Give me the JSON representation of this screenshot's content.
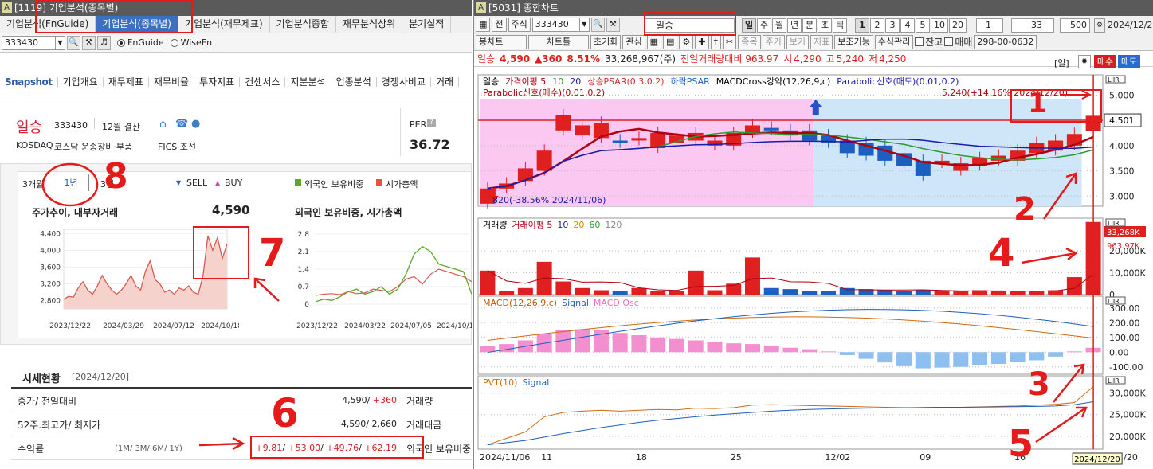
{
  "left": {
    "window_title": "[1119] 기업분석(종목별)",
    "window_icon": "A",
    "tabs": [
      "기업분석(FnGuide)",
      "기업분석(종목별)",
      "기업분석(재무제표)",
      "기업분석종합",
      "재무분석상위",
      "분기실적"
    ],
    "code": "333430",
    "radio_fnguide": "FnGuide",
    "radio_wisefn": "WiseFn",
    "nav": [
      "Snapshot",
      "기업개요",
      "재무제표",
      "재무비율",
      "투자지표",
      "컨센서스",
      "지분분석",
      "업종분석",
      "경쟁사비교",
      "거래"
    ],
    "company": {
      "name": "일승",
      "code": "333430",
      "settlement": "12월 결산",
      "market": "KOSDAQ",
      "sector": "코스닥 운송장비·부품",
      "fics": "FICS 조선",
      "per_label": "PER",
      "per_value": "36.72"
    },
    "period_tabs": [
      "3개월",
      "1년",
      "3년"
    ],
    "legend_sell": "SELL",
    "legend_buy": "BUY",
    "legend_foreign": "외국인 보유비중",
    "legend_mcap": "시가총액",
    "chart1": {
      "title": "주가추이, 내부자거래",
      "price": "4,590",
      "yticks": [
        "4,400",
        "4,000",
        "3,600",
        "3,200",
        "2,800"
      ],
      "xticks": [
        "2023/12/22",
        "2024/03/29",
        "2024/07/12",
        "2024/10/18"
      ]
    },
    "chart2": {
      "title": "외국인 보유비중, 시가총액",
      "yticks": [
        "2.8",
        "2.1",
        "1.4",
        "0.7",
        "0"
      ],
      "xticks": [
        "2023/12/22",
        "2024/03/22",
        "2024/07/05",
        "2024/10/11"
      ]
    },
    "market_status": {
      "title": "시세현황",
      "date": "[2024/12/20]",
      "rows": [
        {
          "label": "종가/ 전일대비",
          "sub": "",
          "value": "4,590/ +360",
          "right": "거래량"
        },
        {
          "label": "52주.최고가/ 최저가",
          "sub": "",
          "value": "4,590/ 2,660",
          "right": "거래대금"
        },
        {
          "label": "수익률",
          "sub": "(1M/ 3M/ 6M/ 1Y)",
          "value": "+9.81/ +53.00/ +49.76/ +62.19",
          "right": "외국인 보유비중"
        }
      ]
    }
  },
  "right": {
    "window_title": "[5031] 종합차트",
    "row1": {
      "jeon": "전",
      "type": "주식",
      "code": "333430",
      "name": "일승",
      "periods": [
        "일",
        "주",
        "월",
        "년",
        "분",
        "초",
        "틱"
      ],
      "nums": [
        "1",
        "2",
        "3",
        "4",
        "5",
        "10",
        "20"
      ],
      "spin": "1",
      "count": "33",
      "count2": "500",
      "date": "2024/12/2"
    },
    "row2": {
      "chart_type": "봉차트",
      "chart_tool": "차트틀",
      "reset": "초기화",
      "interest": "관심",
      "btns": [
        "종목",
        "주기",
        "보기",
        "지표"
      ],
      "aux": "보조기능",
      "formula": "수식관리",
      "balance": "잔고",
      "trade": "매매",
      "account": "298-00-0632"
    },
    "quote": {
      "name": "일승",
      "price": "4,590",
      "change": "▲360",
      "rate": "8.51%",
      "volume": "33,268,967(주)",
      "vol_ratio": "전일거래량대비 963.97",
      "open_label": "시",
      "open": "4,290",
      "high_label": "고",
      "high": "5,240",
      "low_label": "저",
      "low": "4,250",
      "daily": "[일]",
      "buy": "매수",
      "sell": "매도"
    },
    "price_legend": {
      "l1": [
        "일승",
        "가격이평 5",
        "10",
        "20",
        "상승PSAR(0.3,0.2)",
        "하락PSAR",
        "MACDCross강약(12,26,9,c)",
        "Parabolic신호(매도)(0.01,0.2)"
      ],
      "l2": "Parabolic신호(매수)(0.01,0.2)",
      "high_note": "5,240(+14.16% 2024/12/20)",
      "low_note": "820(-38.56% 2024/11/06)",
      "yticks": [
        "5,000",
        "4,500",
        "4,000",
        "3,500",
        "3,000"
      ],
      "last_price": "4,501"
    },
    "volume_legend": {
      "items": [
        "거래량",
        "거래이평 5",
        "10",
        "20",
        "60",
        "120"
      ],
      "yticks": [
        "20,000K",
        "10,000K",
        "0"
      ],
      "vol_tag": "33,268K",
      "pct_tag": "963.97K"
    },
    "macd_legend": {
      "items": [
        "MACD(12,26,9,c)",
        "Signal",
        "MACD Osc"
      ],
      "yticks": [
        "300.00",
        "200.00",
        "100.00",
        "0.00",
        "-100.00"
      ]
    },
    "pvt_legend": {
      "items": [
        "PVT(10)",
        "Signal"
      ],
      "yticks": [
        "30,000K",
        "25,000K",
        "20,000K"
      ]
    },
    "xaxis": {
      "labels": [
        "2024/11/06",
        "11",
        "18",
        "25",
        "12/02",
        "09",
        "16"
      ],
      "current": "2024/12/20",
      "tail": "/20"
    },
    "y_tag_box": "LIIR"
  },
  "annotations": [
    "1",
    "2",
    "3",
    "4",
    "5",
    "6",
    "7",
    "8"
  ],
  "colors": {
    "red": "#e02020",
    "blue": "#1c5fbf",
    "pink_bg": "#fbc8f2",
    "blue_bg": "#cfe6f9",
    "annot": "#e51b1b"
  },
  "chart_data": [
    {
      "type": "line",
      "title": "주가추이, 내부자거래",
      "xlabel": "",
      "ylabel": "",
      "ylim": [
        2600,
        4500
      ],
      "x": [
        "2023/12/22",
        "2024/03/29",
        "2024/07/12",
        "2024/10/18"
      ],
      "series": [
        {
          "values": [
            2830,
            2900,
            2880,
            3100,
            3250,
            3050,
            2950,
            3150,
            3400,
            3200,
            3050,
            2950,
            3050,
            3200,
            3400,
            3150,
            3050,
            3500,
            3750,
            3300,
            3200,
            3000,
            3050,
            2950,
            3100,
            3050,
            3150,
            3000,
            2950,
            3400,
            4350,
            4000,
            4300,
            3800,
            4150
          ]
        }
      ]
    },
    {
      "type": "line",
      "title": "외국인 보유비중, 시가총액",
      "ylim": [
        0,
        2.8
      ],
      "x": [
        "2023/12/22",
        "2024/03/22",
        "2024/07/05",
        "2024/10/11"
      ],
      "series": [
        {
          "values": [
            0.1,
            0.2,
            0.15,
            0.3,
            0.5,
            0.6,
            0.4,
            0.5,
            0.7,
            0.4,
            0.6,
            1.2,
            2.0,
            2.3,
            2.1,
            1.6,
            1.5,
            1.4,
            1.3,
            0.4
          ]
        }
      ]
    },
    {
      "type": "bar",
      "title": "",
      "ylim": [
        2800,
        5400
      ],
      "categories": [
        "11/06",
        "11/07",
        "11/08",
        "11/11",
        "11/12",
        "11/13",
        "11/14",
        "11/15",
        "11/18",
        "11/19",
        "11/20",
        "11/21",
        "11/22",
        "11/25",
        "11/26",
        "11/27",
        "11/28",
        "11/29",
        "12/02",
        "12/03",
        "12/04",
        "12/05",
        "12/06",
        "12/09",
        "12/10",
        "12/11",
        "12/12",
        "12/13",
        "12/16",
        "12/17",
        "12/18",
        "12/19",
        "12/20"
      ],
      "series": [
        {
          "name": "open",
          "values": [
            2850,
            3150,
            3300,
            3500,
            4300,
            4200,
            4150,
            4100,
            4100,
            3950,
            4050,
            4100,
            4000,
            4000,
            4250,
            4350,
            4300,
            4300,
            4200,
            4100,
            4050,
            4000,
            3850,
            3700,
            3650,
            3500,
            3600,
            3700,
            3700,
            3850,
            3900,
            4000,
            4290
          ]
        },
        {
          "name": "close",
          "values": [
            3150,
            3250,
            3550,
            3900,
            4600,
            4400,
            4450,
            4050,
            4150,
            4250,
            4200,
            4250,
            4100,
            4250,
            4400,
            4300,
            4200,
            4100,
            4050,
            3850,
            3800,
            3700,
            3600,
            3400,
            3700,
            3650,
            3750,
            3800,
            3900,
            4050,
            4100,
            4230,
            4590
          ]
        }
      ]
    },
    {
      "type": "bar",
      "title": "",
      "ylim": [
        0,
        35000
      ],
      "categories": [
        "11/06",
        "11/07",
        "11/08",
        "11/11",
        "11/12",
        "11/13",
        "11/14",
        "11/15",
        "11/18",
        "11/19",
        "11/20",
        "11/21",
        "11/22",
        "11/25",
        "11/26",
        "11/27",
        "11/28",
        "11/29",
        "12/02",
        "12/03",
        "12/04",
        "12/05",
        "12/06",
        "12/09",
        "12/10",
        "12/11",
        "12/12",
        "12/13",
        "12/16",
        "12/17",
        "12/18",
        "12/19",
        "12/20"
      ],
      "series": [
        {
          "name": "거래량",
          "values": [
            11000,
            1500,
            3000,
            15000,
            6000,
            3000,
            2000,
            1500,
            3000,
            1500,
            1500,
            11000,
            2000,
            5000,
            17000,
            3000,
            2500,
            1500,
            1500,
            3000,
            2500,
            2000,
            1500,
            2000,
            1500,
            1500,
            2000,
            1500,
            1500,
            1500,
            2000,
            8000,
            33268
          ]
        }
      ]
    },
    {
      "type": "bar",
      "title": "",
      "ylim": [
        -150,
        380
      ],
      "categories": [
        "11/06",
        "11/07",
        "11/08",
        "11/11",
        "11/12",
        "11/13",
        "11/14",
        "11/15",
        "11/18",
        "11/19",
        "11/20",
        "11/21",
        "11/22",
        "11/25",
        "11/26",
        "11/27",
        "11/28",
        "11/29",
        "12/02",
        "12/03",
        "12/04",
        "12/05",
        "12/06",
        "12/09",
        "12/10",
        "12/11",
        "12/12",
        "12/13",
        "12/16",
        "12/17",
        "12/18",
        "12/19",
        "12/20"
      ],
      "series": [
        {
          "name": "MACD Osc",
          "values": [
            40,
            55,
            80,
            120,
            150,
            155,
            150,
            130,
            115,
            100,
            90,
            80,
            70,
            60,
            55,
            45,
            30,
            20,
            5,
            -20,
            -45,
            -70,
            -95,
            -110,
            -105,
            -100,
            -90,
            -80,
            -65,
            -55,
            -30,
            5,
            30
          ]
        }
      ]
    },
    {
      "type": "line",
      "title": "",
      "ylim": [
        17000,
        34000
      ],
      "categories": [
        "11/06",
        "11/07",
        "11/08",
        "11/11",
        "11/12",
        "11/13",
        "11/14",
        "11/15",
        "11/18",
        "11/19",
        "11/20",
        "11/21",
        "11/22",
        "11/25",
        "11/26",
        "11/27",
        "11/28",
        "11/29",
        "12/02",
        "12/03",
        "12/04",
        "12/05",
        "12/06",
        "12/09",
        "12/10",
        "12/11",
        "12/12",
        "12/13",
        "12/16",
        "12/17",
        "12/18",
        "12/19",
        "12/20"
      ],
      "series": [
        {
          "name": "PVT(10)",
          "values": [
            18000,
            19500,
            21000,
            24500,
            25500,
            25800,
            26000,
            25800,
            26000,
            26200,
            26100,
            26500,
            26400,
            26600,
            27200,
            27300,
            27200,
            27100,
            27000,
            26900,
            26800,
            26700,
            26600,
            26600,
            26700,
            26700,
            26800,
            26900,
            27000,
            27200,
            27400,
            27800,
            31500
          ]
        },
        {
          "name": "Signal",
          "values": [
            18000,
            18500,
            19000,
            19800,
            20600,
            21300,
            22000,
            22600,
            23200,
            23700,
            24100,
            24500,
            24900,
            25200,
            25500,
            25800,
            26000,
            26200,
            26300,
            26400,
            26500,
            26550,
            26600,
            26650,
            26700,
            26700,
            26750,
            26800,
            26850,
            26900,
            27000,
            27300,
            28000
          ]
        }
      ]
    }
  ]
}
